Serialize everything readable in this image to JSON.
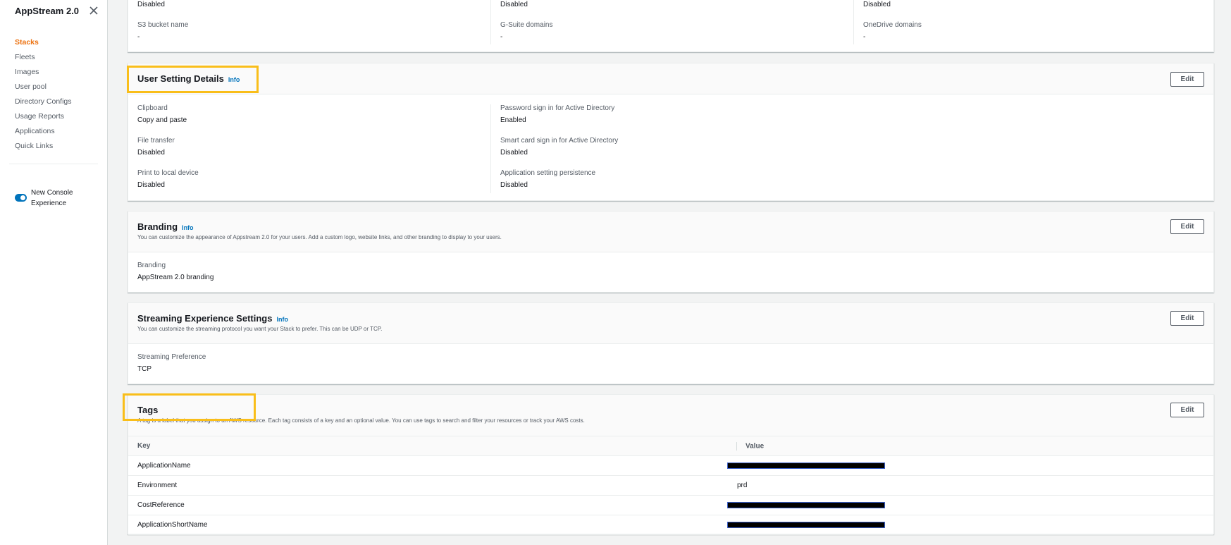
{
  "sidebar": {
    "title": "AppStream 2.0",
    "close_icon": "close-icon",
    "items": [
      {
        "label": "Stacks",
        "active": true
      },
      {
        "label": "Fleets"
      },
      {
        "label": "Images"
      },
      {
        "label": "User pool"
      },
      {
        "label": "Directory Configs"
      },
      {
        "label": "Usage Reports"
      },
      {
        "label": "Applications"
      },
      {
        "label": "Quick Links"
      }
    ],
    "toggle_label": "New Console Experience",
    "toggle_on": true
  },
  "top_card": {
    "row1": [
      "Disabled",
      "Disabled",
      "Disabled"
    ],
    "fields": [
      {
        "label": "S3 bucket name",
        "value": "-"
      },
      {
        "label": "G-Suite domains",
        "value": "-"
      },
      {
        "label": "OneDrive domains",
        "value": "-"
      }
    ]
  },
  "user_settings": {
    "title": "User Setting Details",
    "info": "Info",
    "edit": "Edit",
    "left": [
      {
        "label": "Clipboard",
        "value": "Copy and paste"
      },
      {
        "label": "File transfer",
        "value": "Disabled"
      },
      {
        "label": "Print to local device",
        "value": "Disabled"
      }
    ],
    "right": [
      {
        "label": "Password sign in for Active Directory",
        "value": "Enabled"
      },
      {
        "label": "Smart card sign in for Active Directory",
        "value": "Disabled"
      },
      {
        "label": "Application setting persistence",
        "value": "Disabled"
      }
    ]
  },
  "branding": {
    "title": "Branding",
    "info": "Info",
    "edit": "Edit",
    "desc": "You can customize the appearance of Appstream 2.0 for your users. Add a custom logo, website links, and other branding to display to your users.",
    "label": "Branding",
    "value": "AppStream 2.0 branding"
  },
  "streaming": {
    "title": "Streaming Experience Settings",
    "info": "Info",
    "edit": "Edit",
    "desc": "You can customize the streaming protocol you want your Stack to prefer. This can be UDP or TCP.",
    "label": "Streaming Preference",
    "value": "TCP"
  },
  "tags": {
    "title": "Tags",
    "edit": "Edit",
    "desc": "A tag is a label that you assign to an AWS resource. Each tag consists of a key and an optional value. You can use tags to search and filter your resources or track your AWS costs.",
    "columns": [
      "Key",
      "Value"
    ],
    "rows": [
      {
        "key": "ApplicationName",
        "value": "",
        "redacted": true
      },
      {
        "key": "Environment",
        "value": "prd",
        "redacted": false
      },
      {
        "key": "CostReference",
        "value": "",
        "redacted": true
      },
      {
        "key": "ApplicationShortName",
        "value": "",
        "redacted": true
      }
    ]
  },
  "colors": {
    "accent": "#ec7211",
    "link": "#0073bb",
    "highlight": "#f9be1a"
  }
}
